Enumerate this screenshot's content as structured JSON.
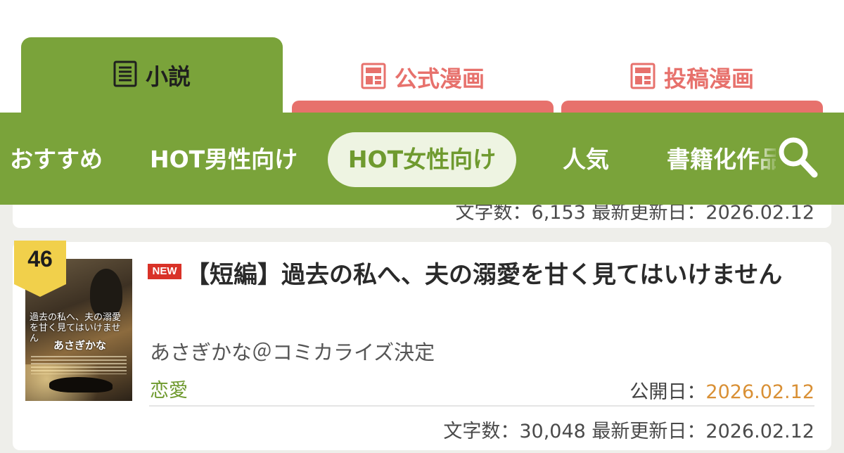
{
  "tabs": [
    {
      "label": "小説",
      "icon": "document-icon",
      "active": true
    },
    {
      "label": "公式漫画",
      "icon": "manga-icon",
      "active": false
    },
    {
      "label": "投稿漫画",
      "icon": "manga-icon",
      "active": false
    }
  ],
  "nav": {
    "items": [
      "おすすめ",
      "HOT男性向け",
      "HOT女性向け",
      "人気",
      "書籍化作品"
    ],
    "active_index": 2,
    "search_icon": "search-icon"
  },
  "entries": [
    {
      "meta": "文字数：6,153  最新更新日：2026.02.12"
    },
    {
      "rank": "46",
      "badge": "NEW",
      "title": "【短編】過去の私へ、夫の溺愛を甘く見てはいけません",
      "author": "あさぎかな＠コミカライズ決定",
      "genre": "恋愛",
      "published_label": "公開日：",
      "published_date": "2026.02.12",
      "meta": "文字数：30,048  最新更新日：2026.02.12",
      "cover": {
        "title_line": "過去の私へ、夫の溺愛を甘く見てはいけません",
        "author_line": "あさぎかな"
      }
    }
  ],
  "colors": {
    "brand_green": "#7aa33a",
    "manga_red": "#e7716c",
    "date_orange": "#d99035",
    "new_red": "#d93228",
    "rank_gold": "#f1d04b"
  }
}
